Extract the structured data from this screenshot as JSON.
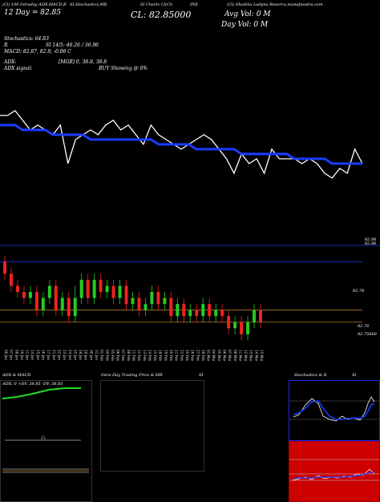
{
  "header": {
    "line1": "(Cl) 100 Intraday ADX,MACD,B",
    "line1b": "SI,Stochastics,MR",
    "line1c": "SI Charts Cl(Cl)",
    "line1d": "INE",
    "line1e": "(Cl) Shaikha Ladyna Resorcu,munafasutra.com",
    "open": "12 Day = 82.85",
    "close": "CL: 82.85000",
    "avg": "Avg Vol: 0  M",
    "dayvol": "Day Vol: 0  M"
  },
  "stochastics": {
    "label": "Stochastics: 64.83",
    "r_label": "R",
    "si": "SI 14/5: 46.26 / 36.96",
    "macd": "MACD: 82.87, 82.9, -0.08 C"
  },
  "adx": {
    "label": "ADX:",
    "mgb": "[MGB] 0, 38.8, 38.8",
    "signal": "ADX signal:",
    "buy": "BUY Showing @ 0%"
  },
  "right_axis": {
    "top1": "82.88",
    "top2": "82.86",
    "mid": "82.78",
    "bot1": "82.76",
    "bot2": "82.75680"
  },
  "x_ticks": [
    "06 Jan",
    "07 Jan",
    "08 Jan",
    "10 Jan",
    "11 Jan",
    "14 Jan",
    "15 Jan",
    "16 Jan",
    "17 Jan",
    "21 Jan",
    "22 Jan",
    "23 Jan",
    "24 Jan",
    "25 Jan",
    "28 Jan",
    "29 Jan",
    "30 Jan",
    "31 Jan",
    "01 Feb",
    "04 Feb",
    "05 Feb",
    "06 Feb",
    "07 Feb",
    "08 Feb",
    "11 Feb",
    "12 Feb",
    "13 Feb",
    "14 Feb",
    "15 Feb",
    "18 Feb",
    "19 Feb",
    "20 Feb",
    "21 Feb",
    "22 Feb",
    "25 Feb",
    "26 Feb",
    "27 Feb",
    "28 Feb",
    "01 Mar",
    "04 Mar",
    "05 Mar",
    "06 Mar",
    "07 Mar",
    "08 Mar",
    "11 Mar",
    "12 Mar",
    "13 Mar",
    "14 Mar",
    "15 Mar"
  ],
  "bottom": {
    "adx_title": "ADX & MACD",
    "adx_vals": "ADX: 0  +DY: 38.85  -DY: 38.85",
    "intraday_title": "Intra Day Trading Price & MR",
    "intraday_si": "SI",
    "stoch_title": "Stochastics & R",
    "stoch_si": "SI"
  },
  "colors": {
    "price_line": "#ffffff",
    "avg_line": "#1a3cff",
    "up": "#22cc22",
    "down": "#ee2222",
    "ref_line": "#b87a2a",
    "adx_plus": "#22dd22"
  },
  "chart_data": [
    {
      "type": "line",
      "title": "",
      "series": [
        {
          "name": "price",
          "values": [
            82.86,
            82.86,
            82.87,
            82.85,
            82.83,
            82.84,
            82.83,
            82.82,
            82.84,
            82.76,
            82.81,
            82.82,
            82.83,
            82.82,
            82.84,
            82.85,
            82.83,
            82.84,
            82.82,
            82.8,
            82.84,
            82.82,
            82.81,
            82.8,
            82.79,
            82.8,
            82.81,
            82.82,
            82.81,
            82.79,
            82.77,
            82.74,
            82.78,
            82.76,
            82.77,
            82.74,
            82.79,
            82.77,
            82.77,
            82.77,
            82.76,
            82.77,
            82.76,
            82.74,
            82.73,
            82.75,
            82.74,
            82.79,
            82.76
          ]
        },
        {
          "name": "average",
          "values": [
            82.84,
            82.84,
            82.84,
            82.83,
            82.83,
            82.83,
            82.83,
            82.82,
            82.82,
            82.82,
            82.82,
            82.82,
            82.81,
            82.81,
            82.81,
            82.81,
            82.81,
            82.81,
            82.81,
            82.81,
            82.81,
            82.8,
            82.8,
            82.8,
            82.8,
            82.8,
            82.79,
            82.79,
            82.79,
            82.79,
            82.79,
            82.79,
            82.78,
            82.78,
            82.78,
            82.78,
            82.78,
            82.78,
            82.78,
            82.77,
            82.77,
            82.77,
            82.77,
            82.77,
            82.76,
            82.76,
            82.76,
            82.76,
            82.76
          ]
        }
      ],
      "ylim": [
        82.7,
        82.9
      ]
    },
    {
      "type": "bar",
      "title": "",
      "candles": [
        {
          "o": 82.86,
          "c": 82.84,
          "h": 82.87,
          "l": 82.83
        },
        {
          "o": 82.84,
          "c": 82.82,
          "h": 82.85,
          "l": 82.81
        },
        {
          "o": 82.82,
          "c": 82.81,
          "h": 82.83,
          "l": 82.8
        },
        {
          "o": 82.81,
          "c": 82.8,
          "h": 82.82,
          "l": 82.79
        },
        {
          "o": 82.8,
          "c": 82.81,
          "h": 82.82,
          "l": 82.79
        },
        {
          "o": 82.81,
          "c": 82.78,
          "h": 82.82,
          "l": 82.77
        },
        {
          "o": 82.78,
          "c": 82.8,
          "h": 82.81,
          "l": 82.77
        },
        {
          "o": 82.8,
          "c": 82.82,
          "h": 82.83,
          "l": 82.79
        },
        {
          "o": 82.82,
          "c": 82.78,
          "h": 82.83,
          "l": 82.77
        },
        {
          "o": 82.78,
          "c": 82.8,
          "h": 82.81,
          "l": 82.77
        },
        {
          "o": 82.8,
          "c": 82.77,
          "h": 82.81,
          "l": 82.76
        },
        {
          "o": 82.77,
          "c": 82.8,
          "h": 82.82,
          "l": 82.76
        },
        {
          "o": 82.8,
          "c": 82.83,
          "h": 82.84,
          "l": 82.79
        },
        {
          "o": 82.83,
          "c": 82.8,
          "h": 82.84,
          "l": 82.79
        },
        {
          "o": 82.8,
          "c": 82.83,
          "h": 82.84,
          "l": 82.79
        },
        {
          "o": 82.83,
          "c": 82.81,
          "h": 82.84,
          "l": 82.8
        },
        {
          "o": 82.81,
          "c": 82.82,
          "h": 82.83,
          "l": 82.8
        },
        {
          "o": 82.82,
          "c": 82.8,
          "h": 82.83,
          "l": 82.79
        },
        {
          "o": 82.8,
          "c": 82.82,
          "h": 82.83,
          "l": 82.79
        },
        {
          "o": 82.82,
          "c": 82.79,
          "h": 82.83,
          "l": 82.78
        },
        {
          "o": 82.79,
          "c": 82.8,
          "h": 82.81,
          "l": 82.78
        },
        {
          "o": 82.8,
          "c": 82.78,
          "h": 82.81,
          "l": 82.77
        },
        {
          "o": 82.78,
          "c": 82.79,
          "h": 82.8,
          "l": 82.77
        },
        {
          "o": 82.79,
          "c": 82.81,
          "h": 82.82,
          "l": 82.78
        },
        {
          "o": 82.81,
          "c": 82.79,
          "h": 82.82,
          "l": 82.78
        },
        {
          "o": 82.79,
          "c": 82.8,
          "h": 82.81,
          "l": 82.78
        },
        {
          "o": 82.8,
          "c": 82.77,
          "h": 82.81,
          "l": 82.76
        },
        {
          "o": 82.77,
          "c": 82.79,
          "h": 82.8,
          "l": 82.76
        },
        {
          "o": 82.79,
          "c": 82.77,
          "h": 82.8,
          "l": 82.76
        },
        {
          "o": 82.77,
          "c": 82.78,
          "h": 82.79,
          "l": 82.76
        },
        {
          "o": 82.78,
          "c": 82.77,
          "h": 82.79,
          "l": 82.76
        },
        {
          "o": 82.77,
          "c": 82.79,
          "h": 82.8,
          "l": 82.76
        },
        {
          "o": 82.79,
          "c": 82.77,
          "h": 82.8,
          "l": 82.76
        },
        {
          "o": 82.77,
          "c": 82.78,
          "h": 82.79,
          "l": 82.76
        },
        {
          "o": 82.78,
          "c": 82.77,
          "h": 82.79,
          "l": 82.76
        },
        {
          "o": 82.77,
          "c": 82.75,
          "h": 82.78,
          "l": 82.74
        },
        {
          "o": 82.75,
          "c": 82.76,
          "h": 82.77,
          "l": 82.74
        },
        {
          "o": 82.76,
          "c": 82.74,
          "h": 82.77,
          "l": 82.73
        },
        {
          "o": 82.74,
          "c": 82.76,
          "h": 82.77,
          "l": 82.73
        },
        {
          "o": 82.76,
          "c": 82.78,
          "h": 82.79,
          "l": 82.75
        },
        {
          "o": 82.78,
          "c": 82.76,
          "h": 82.79,
          "l": 82.75
        }
      ],
      "ylim": [
        82.72,
        82.9
      ],
      "ref_lines": [
        82.86,
        82.78,
        82.76
      ]
    }
  ]
}
